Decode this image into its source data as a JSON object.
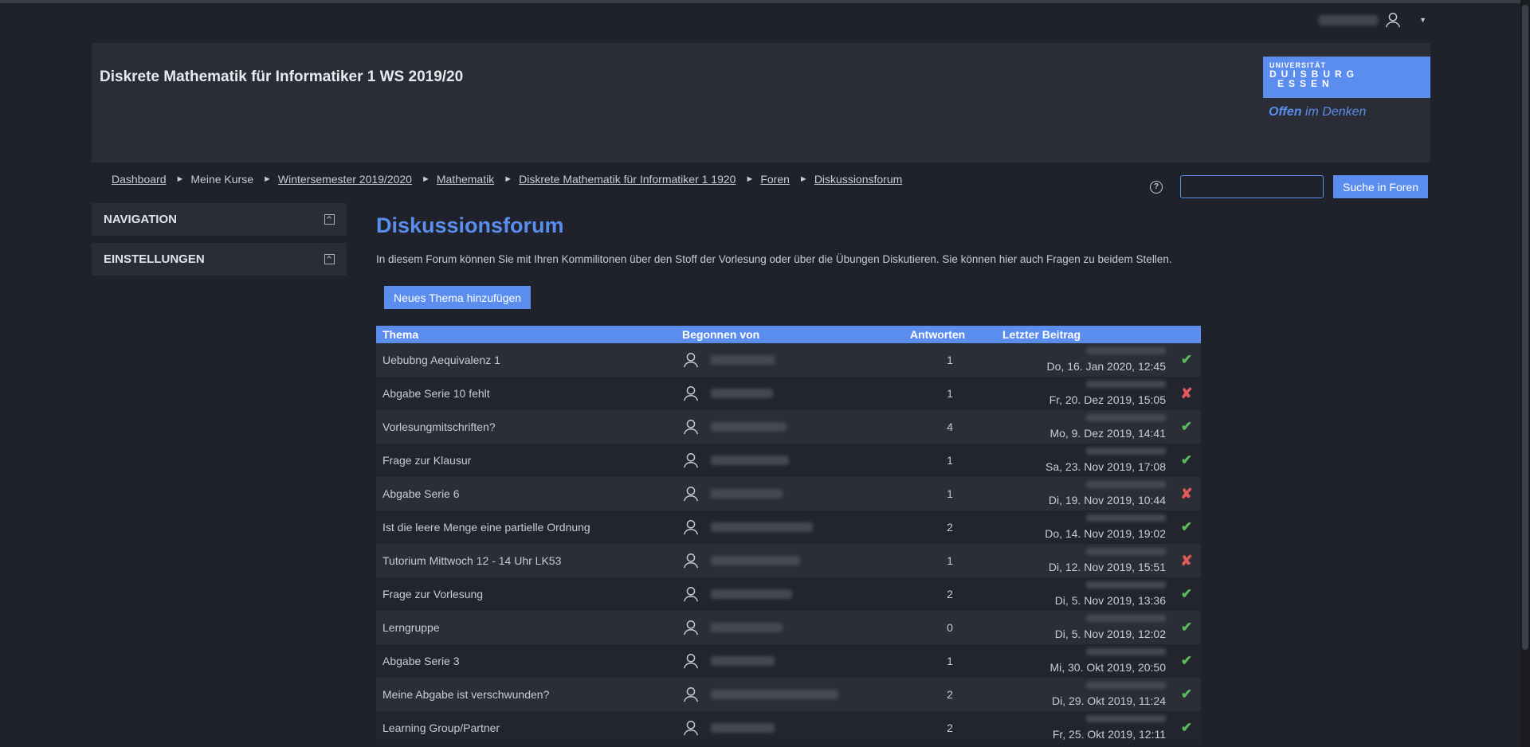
{
  "header": {
    "course_title": "Diskrete Mathematik für Informatiker 1 WS 2019/20",
    "logo": {
      "line1": "UNIVERSITÄT",
      "line2": "DUISBURG",
      "line3": "ESSEN",
      "slogan_bold": "Offen",
      "slogan_rest": " im Denken"
    }
  },
  "breadcrumb": {
    "items": [
      {
        "label": "Dashboard"
      },
      {
        "label": "Meine Kurse"
      },
      {
        "label": "Wintersemester 2019/2020"
      },
      {
        "label": "Mathematik"
      },
      {
        "label": "Diskrete Mathematik für Informatiker 1 1920"
      },
      {
        "label": "Foren"
      },
      {
        "label": "Diskussionsforum"
      }
    ],
    "separator": "►"
  },
  "search": {
    "placeholder": "",
    "button_label": "Suche in Foren",
    "help": "?"
  },
  "sidebar": {
    "blocks": [
      {
        "label": "NAVIGATION"
      },
      {
        "label": "EINSTELLUNGEN"
      }
    ]
  },
  "main": {
    "title": "Diskussionsforum",
    "intro": "In diesem Forum können Sie mit Ihren Kommilitonen über den Stoff der Vorlesung oder über die Übungen Diskutieren. Sie können hier auch Fragen zu beidem Stellen.",
    "new_topic_label": "Neues Thema hinzufügen"
  },
  "table": {
    "headers": {
      "topic": "Thema",
      "started_by": "Begonnen von",
      "replies": "Antworten",
      "last_post": "Letzter Beitrag"
    },
    "rows": [
      {
        "topic": "Uebubng Aequivalenz 1",
        "replies": "1",
        "last": "Do, 16. Jan 2020, 12:45",
        "subscribed": true
      },
      {
        "topic": "Abgabe Serie 10 fehlt",
        "replies": "1",
        "last": "Fr, 20. Dez 2019, 15:05",
        "subscribed": false
      },
      {
        "topic": "Vorlesungmitschriften?",
        "replies": "4",
        "last": "Mo, 9. Dez 2019, 14:41",
        "subscribed": true
      },
      {
        "topic": "Frage zur Klausur",
        "replies": "1",
        "last": "Sa, 23. Nov 2019, 17:08",
        "subscribed": true
      },
      {
        "topic": "Abgabe Serie 6",
        "replies": "1",
        "last": "Di, 19. Nov 2019, 10:44",
        "subscribed": false
      },
      {
        "topic": "Ist die leere Menge eine partielle Ordnung",
        "replies": "2",
        "last": "Do, 14. Nov 2019, 19:02",
        "subscribed": true
      },
      {
        "topic": "Tutorium Mittwoch 12 - 14 Uhr LK53",
        "replies": "1",
        "last": "Di, 12. Nov 2019, 15:51",
        "subscribed": false
      },
      {
        "topic": "Frage zur Vorlesung",
        "replies": "2",
        "last": "Di, 5. Nov 2019, 13:36",
        "subscribed": true
      },
      {
        "topic": "Lerngruppe",
        "replies": "0",
        "last": "Di, 5. Nov 2019, 12:02",
        "subscribed": true
      },
      {
        "topic": "Abgabe Serie 3",
        "replies": "1",
        "last": "Mi, 30. Okt 2019, 20:50",
        "subscribed": true
      },
      {
        "topic": "Meine Abgabe ist verschwunden?",
        "replies": "2",
        "last": "Di, 29. Okt 2019, 11:24",
        "subscribed": true
      },
      {
        "topic": "Learning Group/Partner",
        "replies": "2",
        "last": "Fr, 25. Okt 2019, 12:11",
        "subscribed": true
      }
    ]
  },
  "colors": {
    "accent": "#5b8dee",
    "check": "#5cb85c",
    "cross": "#e05a5a",
    "background": "#1f222a"
  }
}
